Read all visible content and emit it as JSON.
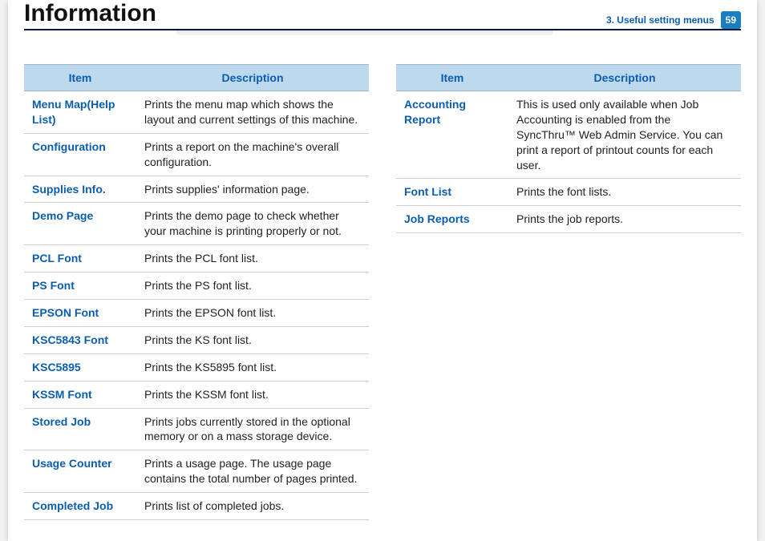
{
  "header": {
    "title": "Information",
    "chapter": "3.  Useful setting menus",
    "page_number": "59"
  },
  "left_table": {
    "headers": {
      "item": "Item",
      "description": "Description"
    },
    "rows": [
      {
        "item": "Menu Map(Help List)",
        "description": "Prints the menu map which shows the layout and current settings of this machine."
      },
      {
        "item": "Configuration",
        "description": "Prints a report on the machine's overall configuration."
      },
      {
        "item": "Supplies Info.",
        "description": "Prints supplies' information page."
      },
      {
        "item": "Demo Page",
        "description": "Prints the demo page to check whether your machine is printing properly or not."
      },
      {
        "item": "PCL Font",
        "description": "Prints the PCL font list."
      },
      {
        "item": "PS Font",
        "description": "Prints the PS font list."
      },
      {
        "item": "EPSON Font",
        "description": "Prints the EPSON font list."
      },
      {
        "item": "KSC5843 Font",
        "description": "Prints the KS font list."
      },
      {
        "item": "KSC5895",
        "description": "Prints the KS5895 font list."
      },
      {
        "item": "KSSM Font",
        "description": "Prints the KSSM font list."
      },
      {
        "item": "Stored Job",
        "description": "Prints jobs currently stored in the optional memory or on a mass storage device."
      },
      {
        "item": "Usage Counter",
        "description": "Prints a usage page. The usage page contains the total number of pages printed."
      },
      {
        "item": "Completed Job",
        "description": "Prints list of completed jobs."
      }
    ]
  },
  "right_table": {
    "headers": {
      "item": "Item",
      "description": "Description"
    },
    "rows": [
      {
        "item": "Accounting Report",
        "description": "This is used only available when Job Accounting is enabled from the SyncThru™ Web Admin Service. You can print a report of printout counts for each user."
      },
      {
        "item": "Font List",
        "description": "Prints the font lists."
      },
      {
        "item": "Job Reports",
        "description": "Prints the job reports."
      }
    ]
  }
}
